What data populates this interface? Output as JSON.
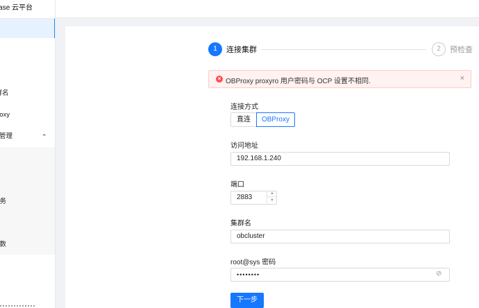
{
  "app": {
    "brand": "OceanBase 云平台"
  },
  "sidebar": {
    "items": [
      {
        "label": "集群名"
      },
      {
        "label": "OBProxy"
      },
      {
        "label": "参数管理"
      },
      {
        "label": "服务"
      },
      {
        "label": "参数"
      }
    ]
  },
  "steps": [
    {
      "number": "1",
      "label": "连接集群"
    },
    {
      "number": "2",
      "label": "预检查"
    }
  ],
  "alert": {
    "message": "OBProxy proxyro 用户密码与 OCP 设置不相同.",
    "close": "×"
  },
  "form": {
    "connect_label": "连接方式",
    "connect_options": [
      "直连",
      "OBProxy"
    ],
    "address_label": "访问地址",
    "address_value": "192.168.1.240",
    "port_label": "端口",
    "port_value": "2883",
    "cluster_label": "集群名",
    "cluster_value": "obcluster",
    "password_label": "root@sys 密码",
    "password_value": "••••••••"
  },
  "next_label": "下一步",
  "colors": {
    "primary": "#1677ff",
    "error": "#ff4d4f"
  }
}
